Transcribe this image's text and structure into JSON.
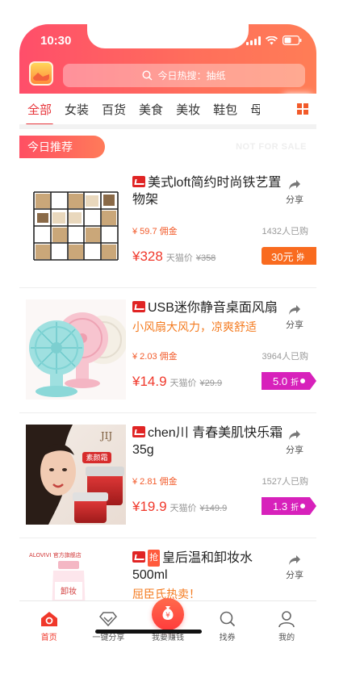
{
  "status_bar": {
    "time": "10:30"
  },
  "search": {
    "placeholder": "今日热搜：抽纸"
  },
  "tabs": [
    "全部",
    "女装",
    "百货",
    "美食",
    "美妆",
    "鞋包",
    "母"
  ],
  "section": {
    "title": "今日推荐",
    "watermark": "NOT FOR SALE"
  },
  "products": [
    {
      "title": "美式loft简约时尚铁艺置物架",
      "subtitle": "",
      "commission": "¥ 59.7 佣金",
      "sold": "1432人已购",
      "price": "¥328",
      "orig_label": "天猫价",
      "orig_price": "¥358",
      "badge_type": "coupon",
      "badge_value": "30元",
      "badge_unit": "券",
      "share_label": "分享"
    },
    {
      "title": "USB迷你静音桌面风扇",
      "subtitle": "小风扇大风力，凉爽舒适",
      "commission": "¥ 2.03 佣金",
      "sold": "3964人已购",
      "price": "¥14.9",
      "orig_label": "天猫价",
      "orig_price": "¥29.9",
      "badge_type": "discount",
      "badge_value": "5.0",
      "badge_unit": "折",
      "share_label": "分享"
    },
    {
      "title": "chen川  青春美肌快乐霜35g",
      "subtitle": "",
      "commission": "¥ 2.81 佣金",
      "sold": "1527人已购",
      "price": "¥19.9",
      "orig_label": "天猫价",
      "orig_price": "¥149.9",
      "badge_type": "discount",
      "badge_value": "1.3",
      "badge_unit": "折",
      "share_label": "分享",
      "image_text": "素颜霜"
    },
    {
      "tag": "抢",
      "title": "皇后温和卸妆水500ml",
      "subtitle": "屈臣氏热卖！",
      "share_label": "分享",
      "image_brand": "ALOVIVI 官方旗舰店",
      "image_text": "卸妆"
    }
  ],
  "bottom_nav": [
    {
      "label": "首页",
      "icon": "home-icon",
      "active": true
    },
    {
      "label": "一键分享",
      "icon": "diamond-icon",
      "active": false
    },
    {
      "label": "我要赚钱",
      "icon": "money-bag-icon",
      "active": false
    },
    {
      "label": "找券",
      "icon": "search-icon",
      "active": false
    },
    {
      "label": "我的",
      "icon": "user-icon",
      "active": false
    }
  ],
  "colors": {
    "accent": "#f0382b",
    "header_start": "#ff4e6a",
    "header_end": "#ff7d56",
    "coupon": "#f96b1f",
    "discount": "#d721bb"
  }
}
